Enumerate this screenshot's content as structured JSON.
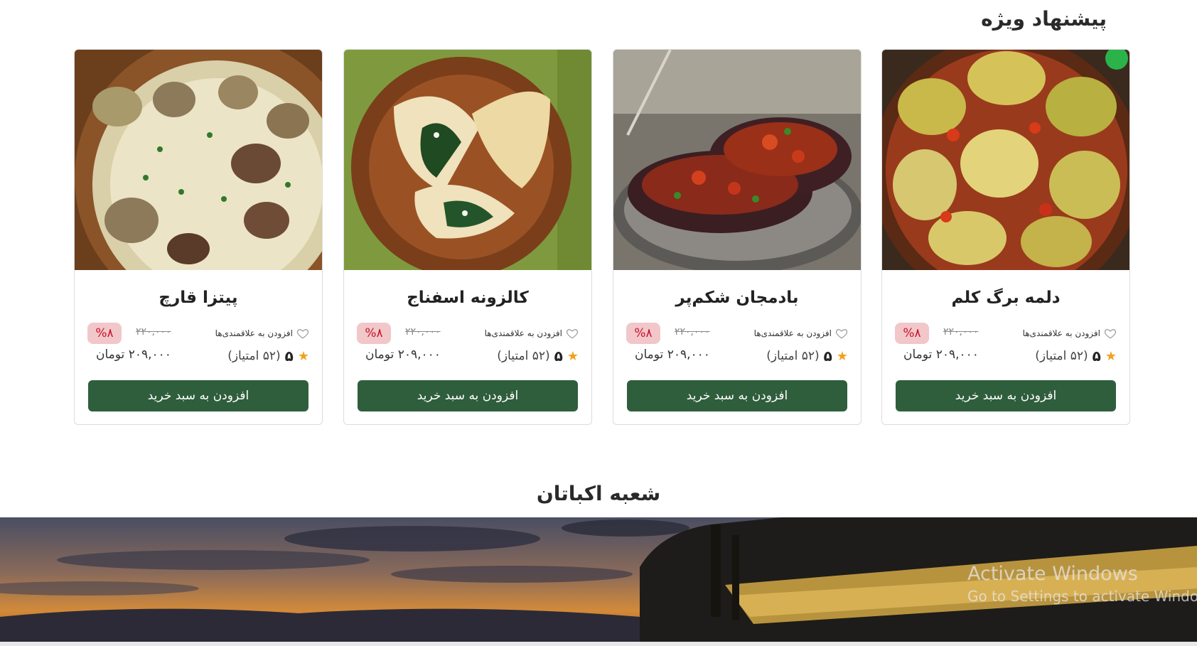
{
  "section_title": "پیشنهاد ویژه",
  "branch_title": "شعبه اکباتان",
  "colors": {
    "button": "#2f5e3c",
    "discount_bg": "#f2c7c9",
    "discount_text": "#c8102e",
    "star": "#f0a21b"
  },
  "products": [
    {
      "name": "دلمه برگ کلم",
      "wishlist_label": "افزودن به علاقمندی‌ها",
      "discount": "%۸",
      "old_price": "۲۲۰,۰۰۰",
      "rating": "۵",
      "rating_count": "(۵۲ امتیاز)",
      "price": "۲۰۹,۰۰۰ تومان",
      "cart_label": "افزودن به سبد خرید",
      "image": "cabbage-rolls-photo"
    },
    {
      "name": "بادمجان شکم‌پر",
      "wishlist_label": "افزودن به علاقمندی‌ها",
      "discount": "%۸",
      "old_price": "۲۲۰,۰۰۰",
      "rating": "۵",
      "rating_count": "(۵۲ امتیاز)",
      "price": "۲۰۹,۰۰۰ تومان",
      "cart_label": "افزودن به سبد خرید",
      "image": "stuffed-eggplant-photo"
    },
    {
      "name": "کالزونه اسفناج",
      "wishlist_label": "افزودن به علاقمندی‌ها",
      "discount": "%۸",
      "old_price": "۲۲۰,۰۰۰",
      "rating": "۵",
      "rating_count": "(۵۲ امتیاز)",
      "price": "۲۰۹,۰۰۰ تومان",
      "cart_label": "افزودن به سبد خرید",
      "image": "spinach-calzone-photo"
    },
    {
      "name": "پیتزا قارچ",
      "wishlist_label": "افزودن به علاقمندی‌ها",
      "discount": "%۸",
      "old_price": "۲۲۰,۰۰۰",
      "rating": "۵",
      "rating_count": "(۵۲ امتیاز)",
      "price": "۲۰۹,۰۰۰ تومان",
      "cart_label": "افزودن به سبد خرید",
      "image": "mushroom-pizza-photo"
    }
  ],
  "icons": {
    "wishlist": "heart-outline-icon",
    "rating": "star-icon"
  },
  "banner_image": "sunset-restaurant-photo",
  "watermark": {
    "title": "Activate Windows",
    "subtitle": "Go to Settings to activate Windows."
  }
}
